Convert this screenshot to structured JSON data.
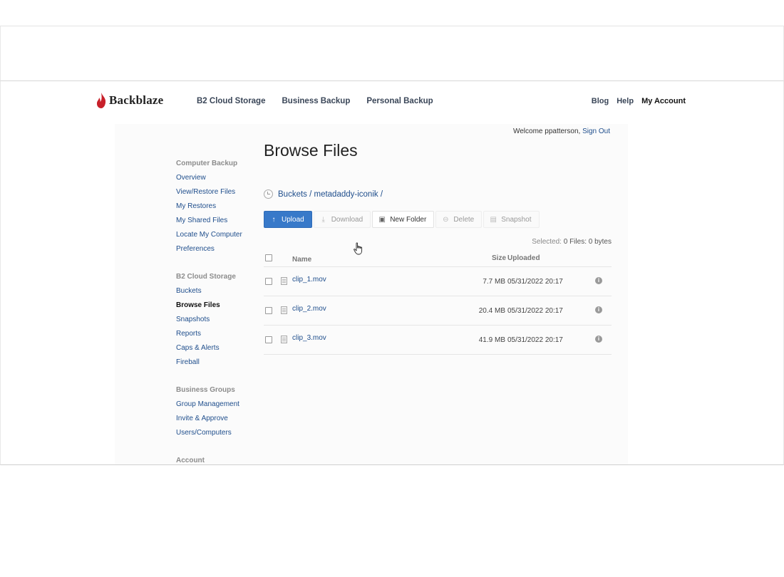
{
  "brand": {
    "name": "Backblaze",
    "color": "#c8202a"
  },
  "top_nav": [
    "B2 Cloud Storage",
    "Business Backup",
    "Personal Backup"
  ],
  "right_nav": {
    "blog": "Blog",
    "help": "Help",
    "account": "My Account"
  },
  "welcome": {
    "text": "Welcome ppatterson,",
    "sign_out": "Sign Out"
  },
  "sidebar": {
    "groups": [
      {
        "heading": "Computer Backup",
        "items": [
          "Overview",
          "View/Restore Files",
          "My Restores",
          "My Shared Files",
          "Locate My Computer",
          "Preferences"
        ]
      },
      {
        "heading": "B2 Cloud Storage",
        "items": [
          "Buckets",
          "Browse Files",
          "Snapshots",
          "Reports",
          "Caps & Alerts",
          "Fireball"
        ],
        "active": "Browse Files"
      },
      {
        "heading": "Business Groups",
        "items": [
          "Group Management",
          "Invite & Approve",
          "Users/Computers"
        ]
      },
      {
        "heading": "Account",
        "items": []
      }
    ]
  },
  "page": {
    "title": "Browse Files",
    "breadcrumb": "Buckets / metadaddy-iconik /"
  },
  "toolbar": {
    "upload": "Upload",
    "download": "Download",
    "new_folder": "New Folder",
    "delete": "Delete",
    "snapshot": "Snapshot"
  },
  "selection": {
    "label": "Selected:",
    "value": "0 Files: 0 bytes"
  },
  "table": {
    "headers": {
      "name": "Name",
      "size": "Size",
      "uploaded": "Uploaded"
    },
    "rows": [
      {
        "name": "clip_1.mov",
        "size": "7.7 MB",
        "uploaded": "05/31/2022 20:17"
      },
      {
        "name": "clip_2.mov",
        "size": "20.4 MB",
        "uploaded": "05/31/2022 20:17"
      },
      {
        "name": "clip_3.mov",
        "size": "41.9 MB",
        "uploaded": "05/31/2022 20:17"
      }
    ]
  },
  "colors": {
    "link": "#1f4e8c",
    "primary_button": "#3879c9"
  }
}
